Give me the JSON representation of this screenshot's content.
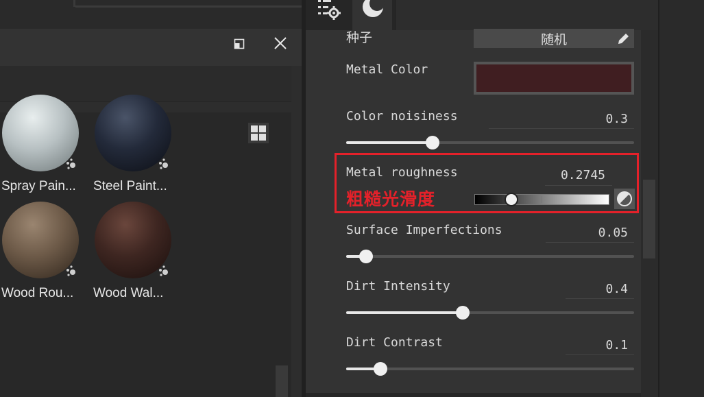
{
  "materials": [
    {
      "label": "Spray Pain...",
      "color": "#b7c0c2"
    },
    {
      "label": "Steel Paint...",
      "color": "#232a3a"
    },
    {
      "label": "Wood Rou...",
      "color": "#6d5a48"
    },
    {
      "label": "Wood Wal...",
      "color": "#3e2621"
    }
  ],
  "properties": {
    "seed": {
      "label": "种子",
      "button_label": "随机"
    },
    "metal_color": {
      "label": "Metal Color",
      "color": "#401e21"
    },
    "color_noisiness": {
      "label": "Color noisiness",
      "value": "0.3",
      "fraction": 0.3
    },
    "metal_roughness": {
      "label": "Metal roughness",
      "value": "0.2745",
      "annotation": "粗糙光滑度",
      "fraction": 0.2745
    },
    "surface_imperfections": {
      "label": "Surface Imperfections",
      "value": "0.05",
      "fraction": 0.07
    },
    "dirt_intensity": {
      "label": "Dirt Intensity",
      "value": "0.4",
      "fraction": 0.405
    },
    "dirt_contrast": {
      "label": "Dirt Contrast",
      "value": "0.1",
      "fraction": 0.12
    }
  },
  "colors": {
    "highlight": "#e4212a",
    "panel": "#333333"
  },
  "icons": [
    "restore-window-icon",
    "close-icon",
    "grid-view-icon",
    "settings-list-icon",
    "moon-icon",
    "pencil-icon",
    "invert-icon",
    "particles-icon"
  ]
}
